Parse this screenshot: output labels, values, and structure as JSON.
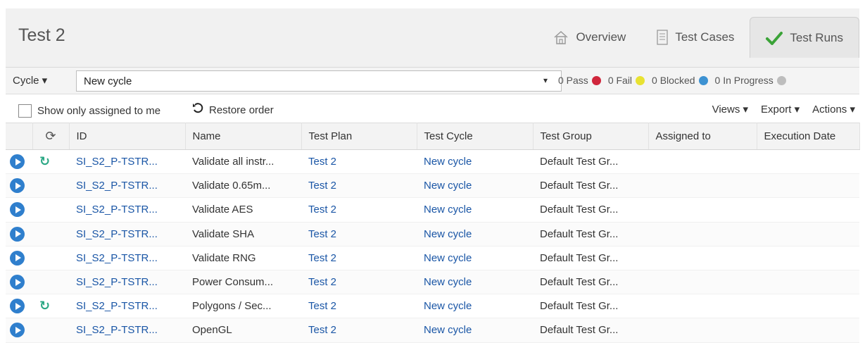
{
  "header": {
    "title": "Test 2",
    "tabs": [
      {
        "label": "Overview",
        "icon": "home-icon",
        "active": false
      },
      {
        "label": "Test Cases",
        "icon": "document-icon",
        "active": false
      },
      {
        "label": "Test Runs",
        "icon": "checkmark-icon",
        "active": true
      }
    ]
  },
  "cycle_bar": {
    "dropdown_label": "Cycle ▾",
    "cycle_value": "New cycle",
    "select_arrow": "▾",
    "status": [
      {
        "label": "0 Pass",
        "color": "#d0263c"
      },
      {
        "label": "0 Fail",
        "color": "#e8e232"
      },
      {
        "label": "0 Blocked",
        "color": "#3d92d2"
      },
      {
        "label": "0 In Progress",
        "color": "#bdbdbd"
      }
    ]
  },
  "toolbar": {
    "assigned_label": "Show only assigned to me",
    "restore_label": "Restore order",
    "views_label": "Views ▾",
    "export_label": "Export ▾",
    "actions_label": "Actions ▾"
  },
  "table": {
    "columns": [
      "",
      "⟳",
      "ID",
      "Name",
      "Test Plan",
      "Test Cycle",
      "Test Group",
      "Assigned to",
      "Execution Date"
    ],
    "rows": [
      {
        "synced": true,
        "id": "SI_S2_P-TSTR...",
        "name": "Validate all instr...",
        "plan": "Test 2",
        "cycle": "New cycle",
        "group": "Default Test Gr...",
        "assigned": "",
        "date": ""
      },
      {
        "synced": false,
        "id": "SI_S2_P-TSTR...",
        "name": "Validate 0.65m...",
        "plan": "Test 2",
        "cycle": "New cycle",
        "group": "Default Test Gr...",
        "assigned": "",
        "date": ""
      },
      {
        "synced": false,
        "id": "SI_S2_P-TSTR...",
        "name": "Validate AES",
        "plan": "Test 2",
        "cycle": "New cycle",
        "group": "Default Test Gr...",
        "assigned": "",
        "date": ""
      },
      {
        "synced": false,
        "id": "SI_S2_P-TSTR...",
        "name": "Validate SHA",
        "plan": "Test 2",
        "cycle": "New cycle",
        "group": "Default Test Gr...",
        "assigned": "",
        "date": ""
      },
      {
        "synced": false,
        "id": "SI_S2_P-TSTR...",
        "name": "Validate RNG",
        "plan": "Test 2",
        "cycle": "New cycle",
        "group": "Default Test Gr...",
        "assigned": "",
        "date": ""
      },
      {
        "synced": false,
        "id": "SI_S2_P-TSTR...",
        "name": "Power Consum...",
        "plan": "Test 2",
        "cycle": "New cycle",
        "group": "Default Test Gr...",
        "assigned": "",
        "date": ""
      },
      {
        "synced": true,
        "id": "SI_S2_P-TSTR...",
        "name": "Polygons / Sec...",
        "plan": "Test 2",
        "cycle": "New cycle",
        "group": "Default Test Gr...",
        "assigned": "",
        "date": ""
      },
      {
        "synced": false,
        "id": "SI_S2_P-TSTR...",
        "name": "OpenGL",
        "plan": "Test 2",
        "cycle": "New cycle",
        "group": "Default Test Gr...",
        "assigned": "",
        "date": ""
      }
    ]
  }
}
